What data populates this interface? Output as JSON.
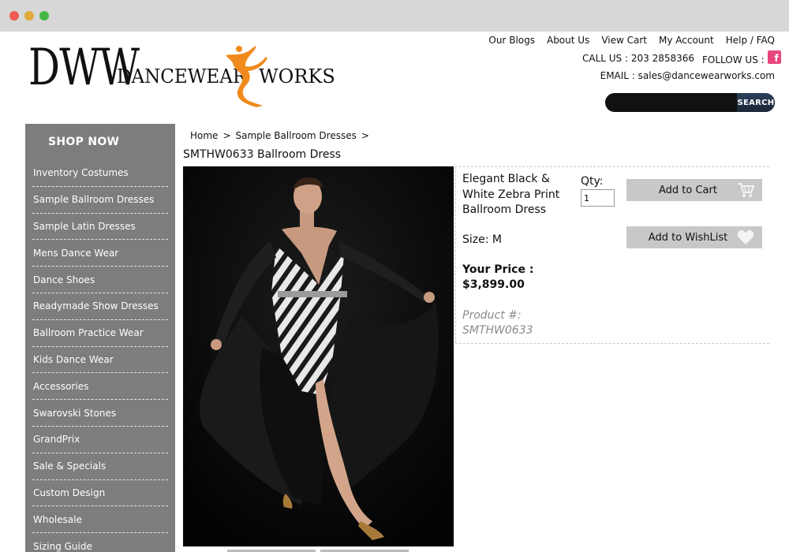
{
  "logo": {
    "dww": "DWW",
    "dance": "DANCEWEAR",
    "works": "WORKS"
  },
  "top_links": [
    "Our Blogs",
    "About Us",
    "View Cart",
    "My Account",
    "Help / FAQ"
  ],
  "contact": {
    "call": "CALL US : 203 2858366",
    "follow": "FOLLOW US :",
    "facebook_glyph": "f",
    "email": "EMAIL : sales@dancewearworks.com"
  },
  "search": {
    "button": "SEARCH",
    "placeholder": ""
  },
  "sidebar": {
    "title": "SHOP NOW",
    "items": [
      "Inventory Costumes",
      "Sample Ballroom Dresses",
      "Sample Latin Dresses",
      "Mens Dance Wear",
      "Dance Shoes",
      "Readymade Show Dresses",
      "Ballroom Practice Wear",
      "Kids Dance Wear",
      "Accessories",
      "Swarovski Stones",
      "GrandPrix",
      "Sale & Specials",
      "Custom Design",
      "Wholesale",
      "Sizing Guide"
    ]
  },
  "breadcrumb": {
    "home": "Home",
    "sep": ">",
    "category": "Sample Ballroom Dresses"
  },
  "product": {
    "title": "SMTHW0633 Ballroom Dress",
    "name": "Elegant Black & White Zebra Print Ballroom Dress",
    "size": "Size: M",
    "price_label": "Your Price :",
    "price": "$3,899.00",
    "number_label": "Product #:",
    "number": "SMTHW0633",
    "qty_label": "Qty:",
    "qty_value": "1",
    "add_to_cart": "Add to Cart",
    "add_to_wishlist": "Add to WishList"
  },
  "colors": {
    "sidebar_bg": "#7d7d7d",
    "button_bg": "#c8c8c8",
    "logo_orange": "#f08a1c",
    "facebook": "#e8467c"
  },
  "icons": [
    "dancer-logo-icon",
    "facebook-icon",
    "cart-icon",
    "heart-icon"
  ]
}
